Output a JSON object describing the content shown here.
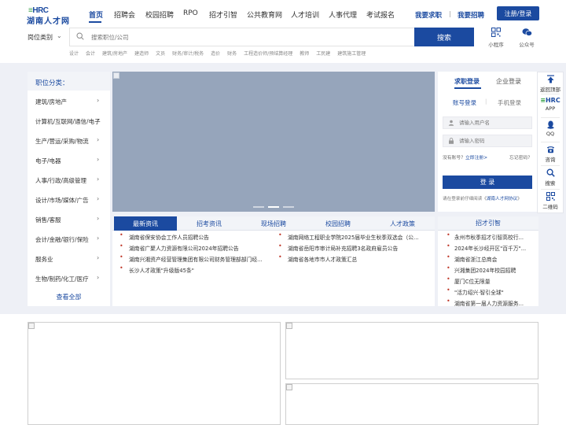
{
  "header": {
    "logo_mark": "HRC",
    "logo_text": "湖南人才网",
    "nav": [
      "首页",
      "招聘会",
      "校园招聘",
      "RPO",
      "招才引智",
      "公共教育网",
      "人才培训",
      "人事代理",
      "考试报名"
    ],
    "job_seek": "我要求职",
    "recruit": "我要招聘",
    "sep": "|",
    "login_register": "注册/登录"
  },
  "search": {
    "category_label": "岗位类别",
    "placeholder": "搜索职位/公司",
    "button": "搜索",
    "miniprogram": "小程序",
    "wechat": "公众号",
    "hot_words": [
      "设计",
      "会计",
      "建筑/房地产",
      "建造师",
      "文员",
      "财务/审计/税务",
      "造价",
      "财务",
      "工程造价师/预结算经理",
      "教师",
      "工民建",
      "建筑施工管理"
    ]
  },
  "categories": {
    "title": "职位分类：",
    "items": [
      "建筑/房地产",
      "计算机/互联网/通信/电子",
      "生产/营运/采购/物流",
      "电子/电器",
      "人事/行政/高级管理",
      "设计/市场/媒体/广告",
      "销售/客服",
      "会计/金融/银行/保险",
      "服务业",
      "生物/制药/化工/医疗"
    ],
    "view_all": "查看全部"
  },
  "login": {
    "tab_job": "求职登录",
    "tab_company": "企业登录",
    "sub_account": "账号登录",
    "sub_phone": "手机登录",
    "sub_sep": "|",
    "username_placeholder": "请输入用户名",
    "password_placeholder": "请输入密码",
    "no_account": "没有账号？",
    "register_now": "立即注册>",
    "forgot": "忘记密码？",
    "button": "登 录",
    "agree_prefix": "请在登录前仔细阅读《",
    "agree_link": "湖南人才网协议",
    "agree_suffix": "》"
  },
  "float_bar": {
    "top": "返回顶部",
    "app": "APP",
    "qq": "QQ",
    "consult": "咨询",
    "search": "搜索",
    "qrcode": "二维码",
    "app_mark": "HRC"
  },
  "news": {
    "tabs": [
      "最新资讯",
      "招考资讯",
      "现场招聘",
      "校园招聘",
      "人才政策"
    ],
    "left": [
      "湖南省保安协会工作人员招聘公告",
      "湖南省广聚人力资源有限公司2024年招聘公告",
      "湖南兴湘资产经营管理集团有限公司财务管理部部门经...",
      "长沙人才政策\"升级版45条\""
    ],
    "right": [
      "湖南网络工程职业学院2025届毕业生秋季双选会（公...",
      "湖南省岳阳市审计局补充招聘3名政府雇员公告",
      "湖南省各地市市人才政策汇总"
    ]
  },
  "talent": {
    "title": "招才引智",
    "items": [
      "永州市秋季招才引智高校行...",
      "2024年长沙经开区\"百千万\"...",
      "湖南省浙江总商会",
      "兴湘集团2024年校园招聘",
      "厦门C位无限量",
      "\"活力绍兴·智引全球\"",
      "湖南省第一届人力资源服务..."
    ]
  },
  "colors": {
    "brand": "#1b4aa0",
    "accent_green": "#3aa34a",
    "bullet_red": "#c0392b",
    "banner": "#96a5bb"
  }
}
